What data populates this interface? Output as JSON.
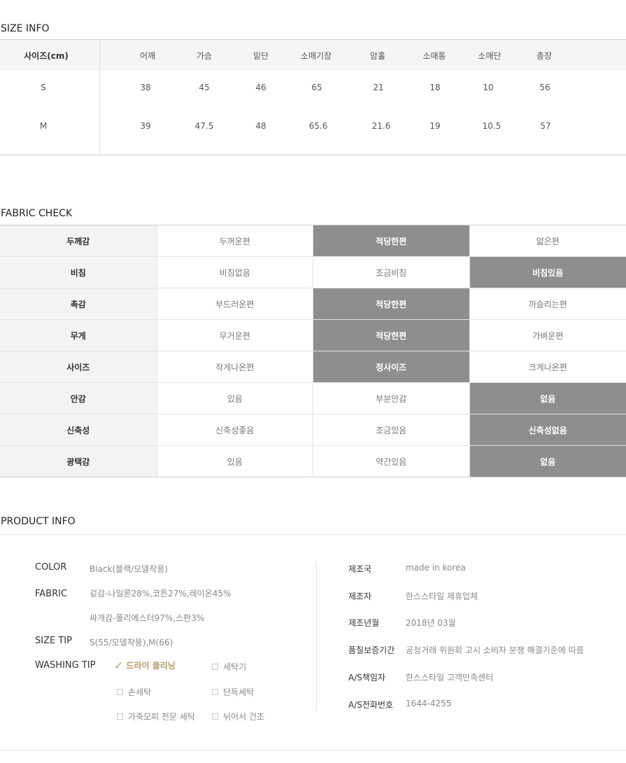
{
  "size_info": {
    "title": "SIZE INFO",
    "headers": [
      "사이즈(cm)",
      "어깨",
      "가슴",
      "밑단",
      "소매기장",
      "암홀",
      "소매통",
      "소매단",
      "총장"
    ],
    "rows": [
      [
        "S",
        "38",
        "45",
        "46",
        "65",
        "21",
        "18",
        "10",
        "56"
      ],
      [
        "M",
        "39",
        "47.5",
        "48",
        "65.6",
        "21.6",
        "19",
        "10.5",
        "57"
      ]
    ]
  },
  "fabric_check": {
    "title": "FABRIC CHECK",
    "rows": [
      {
        "label": "두께감",
        "options": [
          "두꺼운편",
          "적당한편",
          "얇은편"
        ],
        "selected": 1
      },
      {
        "label": "비침",
        "options": [
          "비침없음",
          "조금비침",
          "비침있음"
        ],
        "selected": 2
      },
      {
        "label": "촉감",
        "options": [
          "부드러운편",
          "적당한편",
          "까슬리는편"
        ],
        "selected": 1
      },
      {
        "label": "무게",
        "options": [
          "무거운편",
          "적당한편",
          "가벼운편"
        ],
        "selected": 1
      },
      {
        "label": "사이즈",
        "options": [
          "작게나온편",
          "정사이즈",
          "크게나온편"
        ],
        "selected": 1
      },
      {
        "label": "안감",
        "options": [
          "있음",
          "부분안감",
          "없음"
        ],
        "selected": 2
      },
      {
        "label": "신축성",
        "options": [
          "신축성좋음",
          "조금있음",
          "신축성없음"
        ],
        "selected": 2
      },
      {
        "label": "광택감",
        "options": [
          "있음",
          "약간있음",
          "없음"
        ],
        "selected": 2
      }
    ]
  },
  "product_info": {
    "title": "PRODUCT INFO",
    "color_label": "COLOR",
    "color_value": "Black(블랙/모델착용)",
    "fabric_label": "FABRIC",
    "fabric_value_1": "겉감-나일론28%,코튼27%,레이온45%",
    "fabric_value_2": "싸개감-폴리에스터97%,스판3%",
    "size_tip_label": "SIZE TIP",
    "size_tip_value": "S(55/모델착용),M(66)",
    "washing_tip_label": "WASHING TIP",
    "washing_options": [
      {
        "label": "드라이 클리닝",
        "checked": true
      },
      {
        "label": "세탁기",
        "checked": false
      },
      {
        "label": "손세탁",
        "checked": false
      },
      {
        "label": "단독세탁",
        "checked": false
      },
      {
        "label": "가죽모피 전문 세탁",
        "checked": false
      },
      {
        "label": "뉘어서 건조",
        "checked": false
      }
    ],
    "details": [
      {
        "label": "제조국",
        "value": "made in korea"
      },
      {
        "label": "제조자",
        "value": "한스스타일 제휴업체"
      },
      {
        "label": "제조년월",
        "value": "2018년 03월"
      },
      {
        "label": "품질보증기간",
        "value": "공정거래 위원회 고시 소비자 분쟁 해결기준에 따름"
      },
      {
        "label": "A/S책임자",
        "value": "한스스타일 고객만족센터"
      },
      {
        "label": "A/S전화번호",
        "value": "1644-4255"
      }
    ],
    "accent_color": "#b59a6a",
    "selected_bg_color": "#8e8e8e"
  }
}
